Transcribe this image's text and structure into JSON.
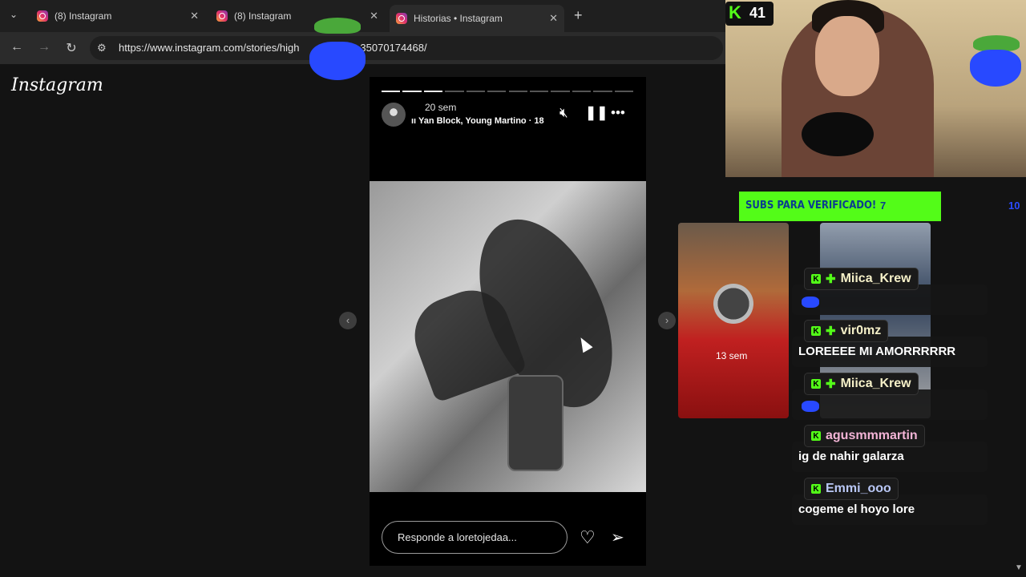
{
  "browser": {
    "tabs": [
      {
        "title": "(8) Instagram"
      },
      {
        "title": "(8) Instagram"
      },
      {
        "title": "Historias • Instagram"
      }
    ],
    "new_tab_label": "+",
    "url_visible_start": "https://www.instagram.com/stories/high",
    "url_visible_end": "35070174468/",
    "icons": [
      "tab-list-icon",
      "back-icon",
      "forward-icon",
      "reload-icon",
      "site-settings-icon",
      "close-icon"
    ]
  },
  "instagram": {
    "logo": "Instagram",
    "story": {
      "time": "20 sem",
      "music": "Yan Block, Young Martino · 18",
      "progress_segments": 12,
      "progress_done": 3,
      "reply_placeholder": "Responde a loretojedaa..."
    },
    "next_preview": {
      "time": "13 sem"
    }
  },
  "stream": {
    "viewer_count": "41",
    "subs_banner": "SUBS PARA VERIFICADO!",
    "subs_count": "7",
    "subs_side": "10",
    "chat": [
      {
        "user": "Miica_Krew",
        "color": "#f5f0c8",
        "badges": [
          "kick",
          "plus"
        ],
        "message": "",
        "emote": true
      },
      {
        "user": "vir0mz",
        "color": "#f5f0c8",
        "badges": [
          "kick",
          "plus"
        ],
        "message": "LOREEEE MI AMORRRRRR",
        "emote": false
      },
      {
        "user": "Miica_Krew",
        "color": "#f5f0c8",
        "badges": [
          "kick",
          "plus"
        ],
        "message": "",
        "emote": true
      },
      {
        "user": "agusmmmartin",
        "color": "#f3b4d6",
        "badges": [
          "kick"
        ],
        "message": "ig de nahir galarza",
        "emote": false
      },
      {
        "user": "Emmi_ooo",
        "color": "#b9c7f5",
        "badges": [
          "kick"
        ],
        "message": "cogeme el hoyo lore",
        "emote": false
      }
    ]
  },
  "colors": {
    "kick_green": "#53fc18",
    "emote_blue": "#2849ff"
  }
}
